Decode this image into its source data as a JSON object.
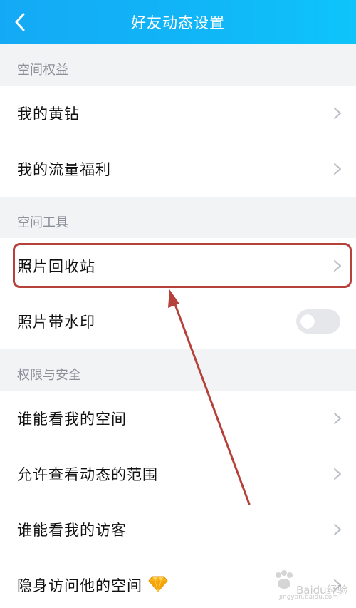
{
  "header": {
    "title": "好友动态设置",
    "back_icon": "chevron-left-icon",
    "color": "#14a9f5"
  },
  "sections": [
    {
      "label": "空间权益",
      "items": [
        {
          "label": "我的黄钻",
          "control": "chevron"
        },
        {
          "label": "我的流量福利",
          "control": "chevron"
        }
      ]
    },
    {
      "label": "空间工具",
      "items": [
        {
          "label": "照片回收站",
          "control": "chevron",
          "highlighted": true
        },
        {
          "label": "照片带水印",
          "control": "toggle",
          "toggle_on": false
        }
      ]
    },
    {
      "label": "权限与安全",
      "items": [
        {
          "label": "谁能看我的空间",
          "control": "chevron"
        },
        {
          "label": "允许查看动态的范围",
          "control": "chevron"
        },
        {
          "label": "谁能看我的访客",
          "control": "chevron"
        },
        {
          "label": "隐身访问他的空间",
          "control": "chevron",
          "badge_icon": "yellow-diamond-icon"
        }
      ]
    }
  ],
  "annotation": {
    "highlight_color": "#b5413a",
    "arrow_color": "#b5413a"
  },
  "watermark": {
    "text": "Baidu经验",
    "url": "jingyan.baidu.com"
  }
}
